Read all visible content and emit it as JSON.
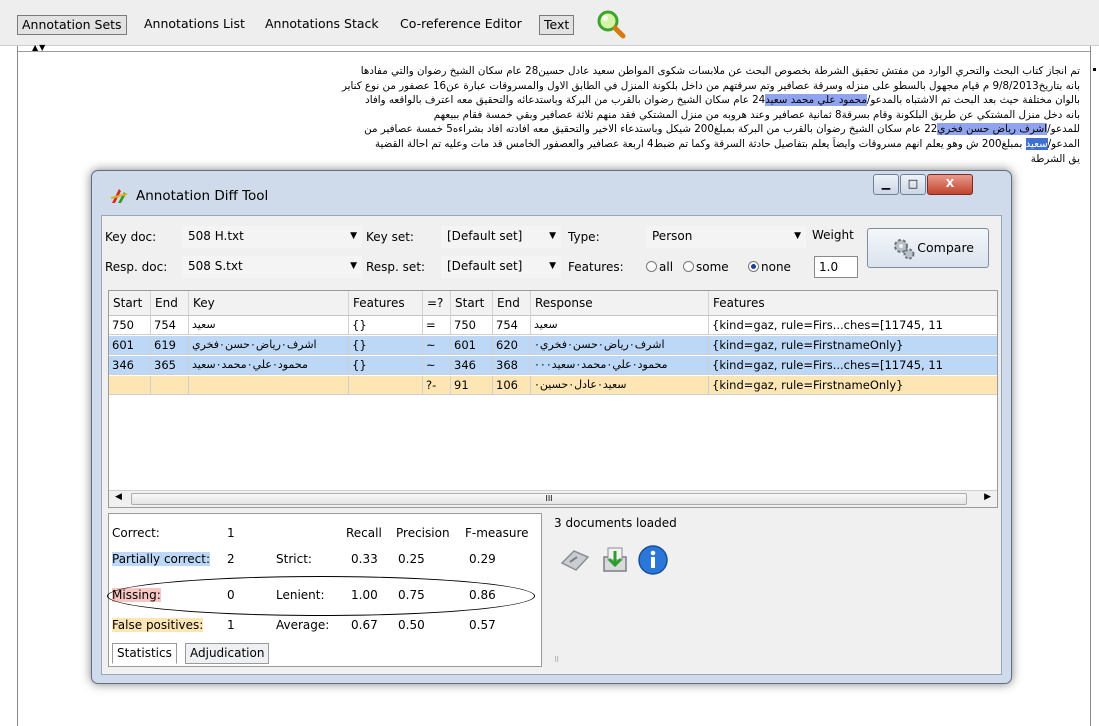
{
  "toolbar": {
    "annotation_sets": "Annotation Sets",
    "annotations_list": "Annotations List",
    "annotations_stack": "Annotations Stack",
    "coreference_editor": "Co-reference Editor",
    "text": "Text",
    "search_icon": "magnifier-icon"
  },
  "document": {
    "lines": [
      [
        "تم انجاز كتاب البحث والتحري الوارد من مفتش تحقيق الشرطة بخصوص البحث عن ملابسات شكوى المواطن سعيد عادل حسين28 عام سكان الشيخ رضوان  والتي مفادها"
      ],
      [
        "بانه بتاريخ9/8/2013 م قيام مجهول بالسطو على منزله وسرقة عصافير وتم سرقتهم من داخل بلكونة المنزل في الطابق الاول والمسروقات عبارة عن16  عصفور من نوع كناير"
      ],
      [
        "بالوان مختلفة حيث بعد البحث تم الاشتباه بالمدعو/",
        "محمود علي محمد سعيد",
        "24 عام سكان الشيخ رضوان بالقرب من البركة وباستدعائه والتحقيق معه اعترف بالواقعه وافاد"
      ],
      [
        "بانه دخل منزل المشتكي عن طريق البلكونة وقام بسرقة8   ثمانية عصافير وعند هروبه من منزل المشتكي فقد منهم ثلاثة عصافير وبقي خمسة فقام ببيعهم"
      ],
      [
        "للمدعو/",
        "اشرف رياض حسن فخري",
        "22 عام سكان الشيخ رضوان بالقرب من البركة بمبلغ200   شيكل وباستدعاء الاخير والتحقيق معه افادته افاد بشراءه5  خمسة عصافير من"
      ],
      [
        "المدعو/",
        "سعيد",
        " بمبلغ200   ش وهو يعلم انهم مسروقات وايضاً يعلم بتفاصيل حادثة السرقة وكما تم ضبط4   اربعة عصافير والعصفور الخامس قد مات وعليه تم احالة القضية"
      ],
      [
        "يق الشرطة"
      ]
    ]
  },
  "dialog": {
    "title": "Annotation Diff Tool",
    "window_buttons": {
      "minimize": "▁",
      "maximize": "□",
      "close": "X"
    },
    "key_doc_label": "Key doc:",
    "key_doc_value": "508 H.txt",
    "resp_doc_label": "Resp. doc:",
    "resp_doc_value": "508 S.txt",
    "key_set_label": "Key set:",
    "key_set_value": "[Default set]",
    "resp_set_label": "Resp. set:",
    "resp_set_value": "[Default set]",
    "type_label": "Type:",
    "type_value": "Person",
    "features_label": "Features:",
    "features_options": [
      "all",
      "some",
      "none"
    ],
    "features_selected": "none",
    "weight_label": "Weight",
    "weight_value": "1.0",
    "compare_label": "Compare",
    "table": {
      "headers": [
        "Start",
        "End",
        "Key",
        "Features",
        "=?",
        "Start",
        "End",
        "Response",
        "Features"
      ],
      "rows": [
        [
          "750",
          "754",
          "سعيد",
          "{}",
          "=",
          "750",
          "754",
          "سعيد",
          "{kind=gaz, rule=Firs...ches=[11745, 11"
        ],
        [
          "601",
          "619",
          "اشرف٠رياض٠حسن٠فخري",
          "{}",
          "~",
          "601",
          "620",
          "اشرف٠رياض٠حسن٠فخري٠",
          "{kind=gaz, rule=FirstnameOnly}"
        ],
        [
          "346",
          "365",
          "محمود٠علي٠محمد٠سعيد",
          "{}",
          "~",
          "346",
          "368",
          "محمود٠علي٠محمد٠سعيد٠٠٠",
          "{kind=gaz, rule=Firs...ches=[11745, 11"
        ],
        [
          "",
          "",
          "",
          "",
          "?-",
          "91",
          "106",
          "سعيد٠عادل٠حسين٠",
          "{kind=gaz, rule=FirstnameOnly}"
        ]
      ],
      "scroll_grip": "III"
    },
    "stats": {
      "correct_label": "Correct:",
      "correct_value": "1",
      "partial_label": "Partially correct:",
      "partial_value": "2",
      "missing_label": "Missing:",
      "missing_value": "0",
      "fp_label": "False positives:",
      "fp_value": "1",
      "col_headers": [
        "Recall",
        "Precision",
        "F-measure"
      ],
      "strict_label": "Strict:",
      "strict": [
        "0.33",
        "0.25",
        "0.29"
      ],
      "lenient_label": "Lenient:",
      "lenient": [
        "1.00",
        "0.75",
        "0.86"
      ],
      "average_label": "Average:",
      "average": [
        "0.67",
        "0.50",
        "0.57"
      ]
    },
    "tabs": [
      "Statistics",
      "Adjudication"
    ],
    "documents_loaded": "3 documents loaded",
    "side_icons": [
      "export-document-icon",
      "download-icon",
      "info-icon"
    ],
    "colors": {
      "partial": "#bcd8f6",
      "missing": "#f8c7c3",
      "false_positive": "#fde6b3"
    }
  }
}
